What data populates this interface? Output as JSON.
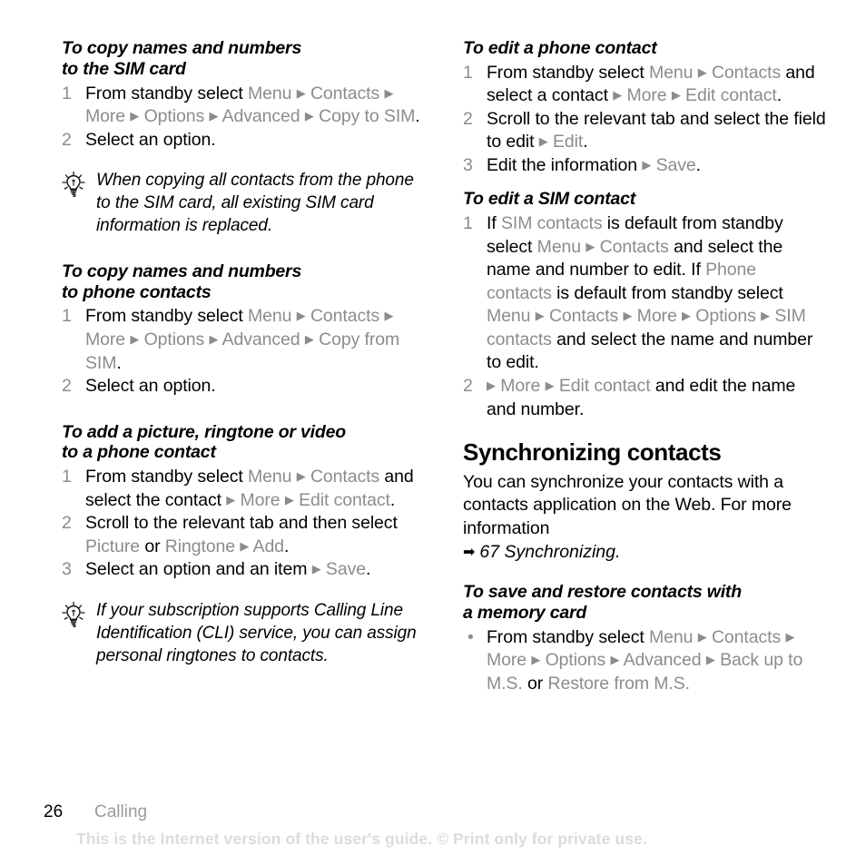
{
  "document": {
    "page_number": "26",
    "chapter": "Calling",
    "watermark": "This is the Internet version of the user's guide. © Print only for private use.",
    "colors": {
      "body_text": "#000000",
      "ui_element_text": "#8c8c8c",
      "watermark": "#dcdcdc",
      "chapter_label": "#9a9a9a"
    }
  },
  "left_column": {
    "proc1": {
      "heading_line1": "To copy names and numbers",
      "heading_line2": "to the SIM card",
      "steps": [
        {
          "number": "1",
          "segments": [
            {
              "text": "From standby select ",
              "style": "body"
            },
            {
              "text": "Menu",
              "style": "ui"
            },
            {
              "text": "▶",
              "style": "tri"
            },
            {
              "text": "Contacts",
              "style": "ui"
            },
            {
              "text": "▶",
              "style": "tri"
            },
            {
              "text": "More",
              "style": "ui"
            },
            {
              "text": "▶",
              "style": "tri"
            },
            {
              "text": "Options",
              "style": "ui"
            },
            {
              "text": "▶",
              "style": "tri"
            },
            {
              "text": "Advanced",
              "style": "ui"
            },
            {
              "text": "▶",
              "style": "tri"
            },
            {
              "text": "Copy to SIM",
              "style": "ui"
            },
            {
              "text": ".",
              "style": "body"
            }
          ]
        },
        {
          "number": "2",
          "segments": [
            {
              "text": "Select an option.",
              "style": "body"
            }
          ]
        }
      ]
    },
    "tip1": {
      "icon": "lightbulb-icon",
      "text": "When copying all contacts from the phone to the SIM card, all existing SIM card information is replaced."
    },
    "proc2": {
      "heading_line1": "To copy names and numbers",
      "heading_line2": "to phone contacts",
      "steps": [
        {
          "number": "1",
          "segments": [
            {
              "text": "From standby select ",
              "style": "body"
            },
            {
              "text": "Menu",
              "style": "ui"
            },
            {
              "text": "▶",
              "style": "tri"
            },
            {
              "text": "Contacts",
              "style": "ui"
            },
            {
              "text": "▶",
              "style": "tri"
            },
            {
              "text": "More",
              "style": "ui"
            },
            {
              "text": "▶",
              "style": "tri"
            },
            {
              "text": "Options",
              "style": "ui"
            },
            {
              "text": "▶",
              "style": "tri"
            },
            {
              "text": "Advanced",
              "style": "ui"
            },
            {
              "text": "▶",
              "style": "tri"
            },
            {
              "text": "Copy from SIM",
              "style": "ui"
            },
            {
              "text": ".",
              "style": "body"
            }
          ]
        },
        {
          "number": "2",
          "segments": [
            {
              "text": "Select an option.",
              "style": "body"
            }
          ]
        }
      ]
    },
    "proc3": {
      "heading_line1": "To add a picture, ringtone or video",
      "heading_line2": "to a phone contact",
      "steps": [
        {
          "number": "1",
          "segments": [
            {
              "text": "From standby select ",
              "style": "body"
            },
            {
              "text": "Menu",
              "style": "ui"
            },
            {
              "text": "▶",
              "style": "tri"
            },
            {
              "text": "Contacts",
              "style": "ui"
            },
            {
              "text": " and select the contact ",
              "style": "body"
            },
            {
              "text": "▶",
              "style": "tri"
            },
            {
              "text": "More",
              "style": "ui"
            },
            {
              "text": "▶",
              "style": "tri"
            },
            {
              "text": "Edit contact",
              "style": "ui"
            },
            {
              "text": ".",
              "style": "body"
            }
          ]
        },
        {
          "number": "2",
          "segments": [
            {
              "text": "Scroll to the relevant tab and then select ",
              "style": "body"
            },
            {
              "text": "Picture",
              "style": "ui"
            },
            {
              "text": " or ",
              "style": "body"
            },
            {
              "text": "Ringtone",
              "style": "ui"
            },
            {
              "text": "▶",
              "style": "tri"
            },
            {
              "text": "Add",
              "style": "ui"
            },
            {
              "text": ".",
              "style": "body"
            }
          ]
        },
        {
          "number": "3",
          "segments": [
            {
              "text": "Select an option and an item ",
              "style": "body"
            },
            {
              "text": "▶",
              "style": "tri"
            },
            {
              "text": "Save",
              "style": "ui"
            },
            {
              "text": ".",
              "style": "body"
            }
          ]
        }
      ]
    },
    "tip2": {
      "icon": "lightbulb-icon",
      "text": "If your subscription supports Calling Line Identification (CLI) service, you can assign personal ringtones to contacts."
    }
  },
  "right_column": {
    "proc4": {
      "heading_line1": "To edit a phone contact",
      "heading_line2": "",
      "steps": [
        {
          "number": "1",
          "segments": [
            {
              "text": "From standby select ",
              "style": "body"
            },
            {
              "text": "Menu",
              "style": "ui"
            },
            {
              "text": "▶",
              "style": "tri"
            },
            {
              "text": "Contacts",
              "style": "ui"
            },
            {
              "text": " and select a contact ",
              "style": "body"
            },
            {
              "text": "▶",
              "style": "tri"
            },
            {
              "text": "More",
              "style": "ui"
            },
            {
              "text": "▶",
              "style": "tri"
            },
            {
              "text": "Edit contact",
              "style": "ui"
            },
            {
              "text": ".",
              "style": "body"
            }
          ]
        },
        {
          "number": "2",
          "segments": [
            {
              "text": "Scroll to the relevant tab and select the field to edit ",
              "style": "body"
            },
            {
              "text": "▶",
              "style": "tri"
            },
            {
              "text": "Edit",
              "style": "ui"
            },
            {
              "text": ".",
              "style": "body"
            }
          ]
        },
        {
          "number": "3",
          "segments": [
            {
              "text": "Edit the information ",
              "style": "body"
            },
            {
              "text": "▶",
              "style": "tri"
            },
            {
              "text": "Save",
              "style": "ui"
            },
            {
              "text": ".",
              "style": "body"
            }
          ]
        }
      ]
    },
    "proc5": {
      "heading_line1": "To edit a SIM contact",
      "heading_line2": "",
      "steps": [
        {
          "number": "1",
          "segments": [
            {
              "text": "If ",
              "style": "body"
            },
            {
              "text": "SIM contacts",
              "style": "ui"
            },
            {
              "text": " is default from standby select ",
              "style": "body"
            },
            {
              "text": "Menu",
              "style": "ui"
            },
            {
              "text": "▶",
              "style": "tri"
            },
            {
              "text": "Contacts",
              "style": "ui"
            },
            {
              "text": " and select the name and number to edit. If ",
              "style": "body"
            },
            {
              "text": "Phone contacts",
              "style": "ui"
            },
            {
              "text": " is default from standby select ",
              "style": "body"
            },
            {
              "text": "Menu",
              "style": "ui"
            },
            {
              "text": "▶",
              "style": "tri"
            },
            {
              "text": "Contacts",
              "style": "ui"
            },
            {
              "text": "▶",
              "style": "tri"
            },
            {
              "text": "More",
              "style": "ui"
            },
            {
              "text": "▶",
              "style": "tri"
            },
            {
              "text": "Options",
              "style": "ui"
            },
            {
              "text": "▶",
              "style": "tri"
            },
            {
              "text": "SIM contacts",
              "style": "ui"
            },
            {
              "text": " and select the name and number to edit.",
              "style": "body"
            }
          ]
        },
        {
          "number": "2",
          "segments": [
            {
              "text": "▶",
              "style": "tri"
            },
            {
              "text": "More",
              "style": "ui"
            },
            {
              "text": "▶",
              "style": "tri"
            },
            {
              "text": "Edit contact",
              "style": "ui"
            },
            {
              "text": " and edit the name and number.",
              "style": "body"
            }
          ]
        }
      ]
    },
    "section": {
      "heading": "Synchronizing contacts",
      "body": "You can synchronize your contacts with a contacts application on the Web. For more information",
      "xref_arrow": "➡",
      "xref_text": "67 Synchronizing."
    },
    "proc6": {
      "heading_line1": "To save and restore contacts with",
      "heading_line2": "a memory card",
      "bullet": "•",
      "steps": [
        {
          "number": "•",
          "segments": [
            {
              "text": "From standby select ",
              "style": "body"
            },
            {
              "text": "Menu",
              "style": "ui"
            },
            {
              "text": "▶",
              "style": "tri"
            },
            {
              "text": "Contacts",
              "style": "ui"
            },
            {
              "text": "▶",
              "style": "tri"
            },
            {
              "text": "More",
              "style": "ui"
            },
            {
              "text": "▶",
              "style": "tri"
            },
            {
              "text": "Options",
              "style": "ui"
            },
            {
              "text": "▶",
              "style": "tri"
            },
            {
              "text": "Advanced",
              "style": "ui"
            },
            {
              "text": "▶",
              "style": "tri"
            },
            {
              "text": "Back up to M.S.",
              "style": "ui"
            },
            {
              "text": " or ",
              "style": "body"
            },
            {
              "text": "Restore from M.S.",
              "style": "ui"
            }
          ]
        }
      ]
    }
  }
}
